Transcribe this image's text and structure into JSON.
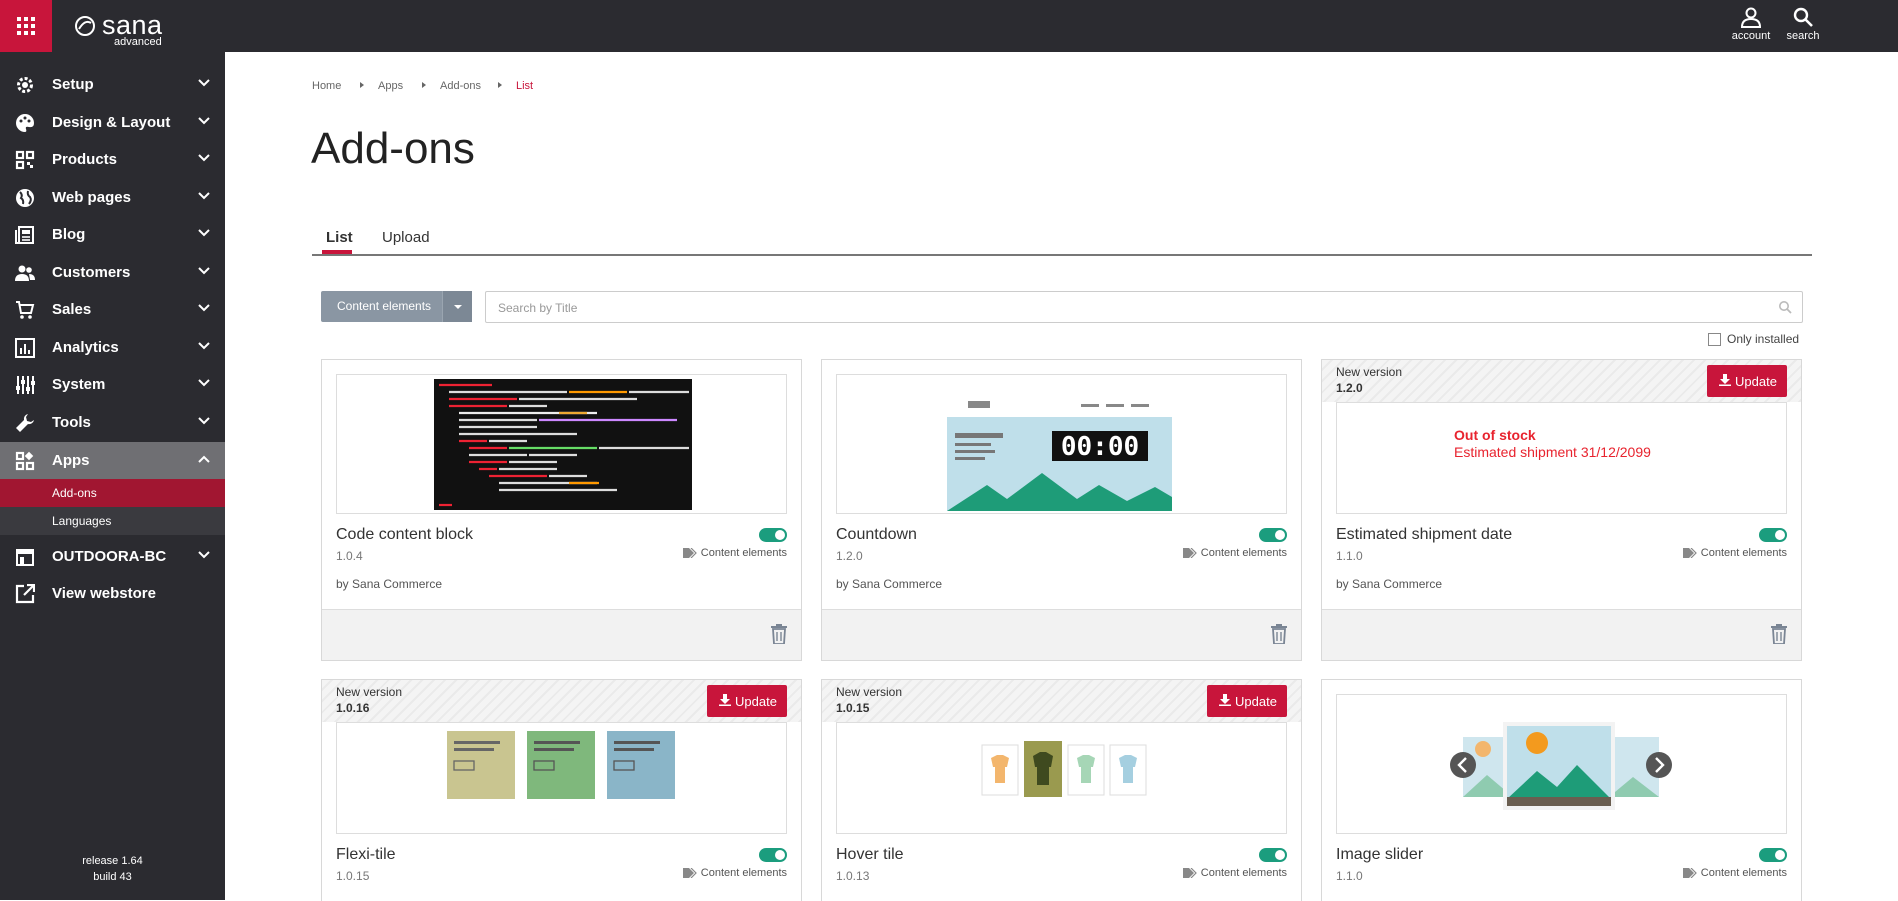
{
  "header": {
    "logo_text": "sana",
    "logo_sub": "advanced",
    "account_label": "account",
    "search_label": "search"
  },
  "sidebar": {
    "items": [
      {
        "label": "Setup",
        "icon": "gear-icon"
      },
      {
        "label": "Design & Layout",
        "icon": "palette-icon"
      },
      {
        "label": "Products",
        "icon": "products-grid-icon"
      },
      {
        "label": "Web pages",
        "icon": "globe-icon"
      },
      {
        "label": "Blog",
        "icon": "newspaper-icon"
      },
      {
        "label": "Customers",
        "icon": "users-icon"
      },
      {
        "label": "Sales",
        "icon": "cart-icon"
      },
      {
        "label": "Analytics",
        "icon": "chart-icon"
      },
      {
        "label": "System",
        "icon": "sliders-icon"
      },
      {
        "label": "Tools",
        "icon": "wrench-icon"
      },
      {
        "label": "Apps",
        "icon": "apps-icon"
      },
      {
        "label": "OUTDOORA-BC",
        "icon": "store-icon"
      },
      {
        "label": "View webstore",
        "icon": "external-link-icon"
      }
    ],
    "sub_items": [
      {
        "label": "Add-ons"
      },
      {
        "label": "Languages"
      }
    ],
    "release": "release 1.64",
    "build": "build 43"
  },
  "breadcrumb": [
    "Home",
    "Apps",
    "Add-ons",
    "List"
  ],
  "page": {
    "title": "Add-ons",
    "tabs": [
      "List",
      "Upload"
    ]
  },
  "filter": {
    "category": "Content elements",
    "search_placeholder": "Search by Title",
    "only_installed": "Only installed"
  },
  "cards": [
    {
      "name": "Code content block",
      "version": "1.0.4",
      "by_prefix": "by",
      "vendor": "Sana Commerce",
      "tag": "Content elements"
    },
    {
      "name": "Countdown",
      "version": "1.2.0",
      "by_prefix": "by",
      "vendor": "Sana Commerce",
      "tag": "Content elements",
      "countdown_display": "00:00"
    },
    {
      "name": "Estimated shipment date",
      "version": "1.1.0",
      "by_prefix": "by",
      "vendor": "Sana Commerce",
      "tag": "Content elements",
      "new_version_label": "New version",
      "new_version": "1.2.0",
      "update_label": "Update",
      "preview_line1": "Out of stock",
      "preview_line2": "Estimated shipment 31/12/2099"
    },
    {
      "name": "Flexi-tile",
      "version": "1.0.15",
      "tag": "Content elements",
      "new_version_label": "New version",
      "new_version": "1.0.16",
      "update_label": "Update"
    },
    {
      "name": "Hover tile",
      "version": "1.0.13",
      "tag": "Content elements",
      "new_version_label": "New version",
      "new_version": "1.0.15",
      "update_label": "Update"
    },
    {
      "name": "Image slider",
      "version": "1.1.0",
      "tag": "Content elements"
    }
  ],
  "colors": {
    "brand": "#c8153b",
    "sidebar_bg": "#2b2b30",
    "toggle_on": "#1b9d7e"
  }
}
